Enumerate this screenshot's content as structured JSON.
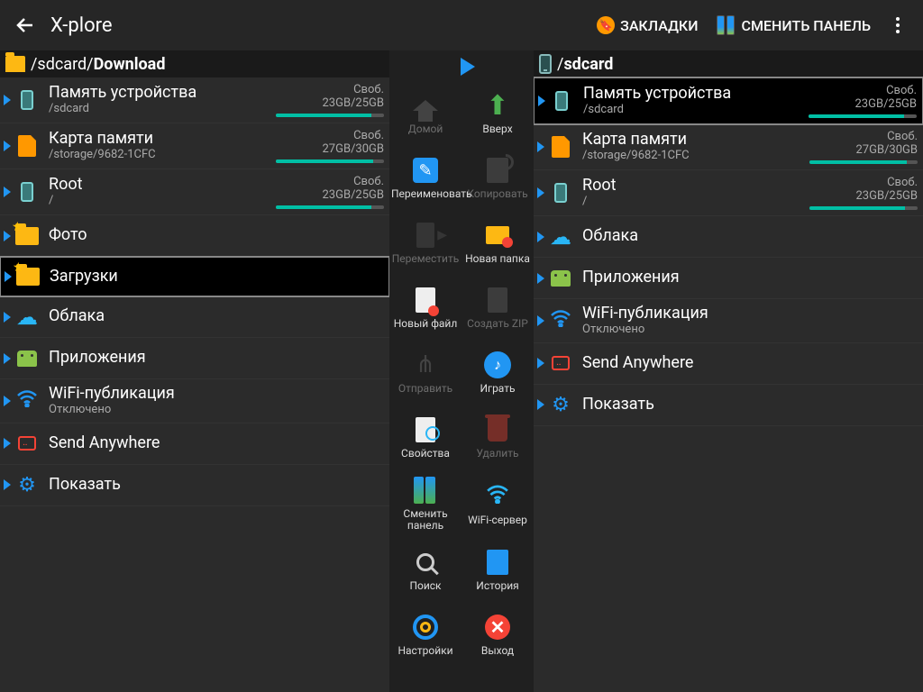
{
  "topbar": {
    "title": "X-plore",
    "bookmarks": "ЗАКЛАДКИ",
    "swap_panel": "СМЕНИТЬ ПАНЕЛЬ"
  },
  "left": {
    "path_prefix": "/sdcard/",
    "path_current": "Download",
    "items": [
      {
        "name": "Память устройства",
        "sub": "/sdcard",
        "free_label": "Своб.",
        "free": "23GB/25GB",
        "fill": 88,
        "icon": "phone"
      },
      {
        "name": "Карта памяти",
        "sub": "/storage/9682-1CFC",
        "free_label": "Своб.",
        "free": "27GB/30GB",
        "fill": 90,
        "icon": "sd"
      },
      {
        "name": "Root",
        "sub": "/",
        "free_label": "Своб.",
        "free": "23GB/25GB",
        "fill": 88,
        "icon": "phone"
      },
      {
        "name": "Фото",
        "icon": "star-folder"
      },
      {
        "name": "Загрузки",
        "icon": "star-folder",
        "selected": true
      },
      {
        "name": "Облака",
        "icon": "cloud"
      },
      {
        "name": "Приложения",
        "icon": "android"
      },
      {
        "name": "WiFi-публикация",
        "sub": "Отключено",
        "icon": "wifi"
      },
      {
        "name": "Send Anywhere",
        "icon": "send"
      },
      {
        "name": "Показать",
        "icon": "gear"
      }
    ]
  },
  "right": {
    "path_prefix": "/",
    "path_current": "sdcard",
    "items": [
      {
        "name": "Память устройства",
        "sub": "/sdcard",
        "free_label": "Своб.",
        "free": "23GB/25GB",
        "fill": 88,
        "icon": "phone",
        "hl": true
      },
      {
        "name": "Карта памяти",
        "sub": "/storage/9682-1CFC",
        "free_label": "Своб.",
        "free": "27GB/30GB",
        "fill": 90,
        "icon": "sd"
      },
      {
        "name": "Root",
        "sub": "/",
        "free_label": "Своб.",
        "free": "23GB/25GB",
        "fill": 88,
        "icon": "phone"
      },
      {
        "name": "Облака",
        "icon": "cloud"
      },
      {
        "name": "Приложения",
        "icon": "android"
      },
      {
        "name": "WiFi-публикация",
        "sub": "Отключено",
        "icon": "wifi"
      },
      {
        "name": "Send Anywhere",
        "icon": "send"
      },
      {
        "name": "Показать",
        "icon": "gear"
      }
    ]
  },
  "tools": [
    {
      "label": "Домой",
      "icon": "home",
      "disabled": true
    },
    {
      "label": "Вверх",
      "icon": "up"
    },
    {
      "label": "Переименовать",
      "icon": "edit"
    },
    {
      "label": "Копировать",
      "icon": "copy",
      "disabled": true
    },
    {
      "label": "Переместить",
      "icon": "move",
      "disabled": true
    },
    {
      "label": "Новая папка",
      "icon": "newfld"
    },
    {
      "label": "Новый файл",
      "icon": "newfile"
    },
    {
      "label": "Создать ZIP",
      "icon": "zip",
      "disabled": true
    },
    {
      "label": "Отправить",
      "icon": "share",
      "disabled": true
    },
    {
      "label": "Играть",
      "icon": "play"
    },
    {
      "label": "Свойства",
      "icon": "info"
    },
    {
      "label": "Удалить",
      "icon": "trash",
      "disabled": true
    },
    {
      "label": "Сменить панель",
      "icon": "swap"
    },
    {
      "label": "WiFi-сервер",
      "icon": "wifisrv"
    },
    {
      "label": "Поиск",
      "icon": "search"
    },
    {
      "label": "История",
      "icon": "hist"
    },
    {
      "label": "Настройки",
      "icon": "settings"
    },
    {
      "label": "Выход",
      "icon": "exit"
    }
  ]
}
